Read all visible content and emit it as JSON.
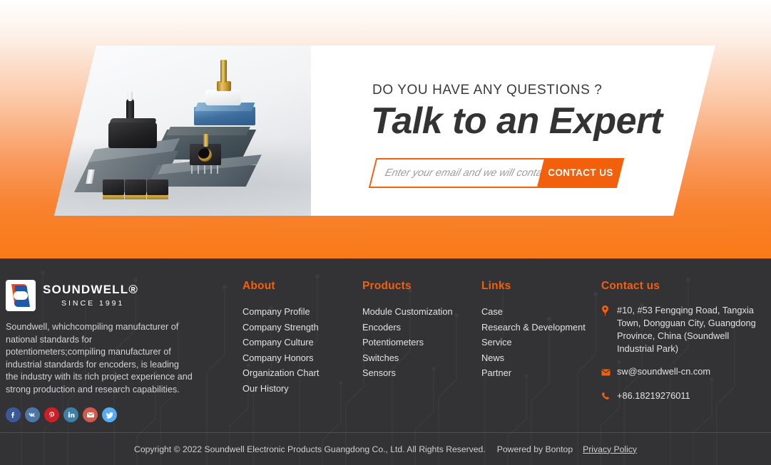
{
  "hero": {
    "eyebrow": "DO YOU HAVE ANY QUESTIONS ?",
    "headline": "Talk to an Expert",
    "email_placeholder": "Enter your email and we will contact you",
    "email_value": "",
    "cta_label": "CONTACT US",
    "accent_color": "#f2600c",
    "background_gradient_from": "#ffffff",
    "background_gradient_to": "#f97a16",
    "photo_alt": "rotary switches, potentiometers and encoders on grey display platforms"
  },
  "footer": {
    "brand": {
      "logo_icon": "soundwell-s-logo-icon",
      "name": "SOUNDWELL®",
      "since": "SINCE 1991",
      "description": "Soundwell, whichcompiling manufacturer of national standards for potentiometers;compiling manufacturer of industrial standards for encoders, is leading the industry with its rich project experience and strong production and research capabilities.",
      "socials": [
        {
          "name": "facebook",
          "icon": "facebook-icon",
          "color": "#3b5998"
        },
        {
          "name": "vk",
          "icon": "vk-icon",
          "color": "#4a76a8"
        },
        {
          "name": "pinterest",
          "icon": "pinterest-icon",
          "color": "#cb2027"
        },
        {
          "name": "linkedin",
          "icon": "linkedin-icon",
          "color": "#3f7fa6"
        },
        {
          "name": "email",
          "icon": "envelope-icon",
          "color": "#cd5c4e"
        },
        {
          "name": "twitter",
          "icon": "twitter-icon",
          "color": "#55acee"
        }
      ]
    },
    "columns": [
      {
        "heading": "About",
        "links": [
          "Company Profile",
          "Company Strength",
          "Company Culture",
          "Company Honors",
          "Organization Chart",
          "Our History"
        ]
      },
      {
        "heading": "Products",
        "links": [
          "Module Customization",
          "Encoders",
          "Potentiometers",
          "Switches",
          "Sensors"
        ]
      },
      {
        "heading": "Links",
        "links": [
          "Case",
          "Research & Development",
          "Service",
          "News",
          "Partner"
        ]
      }
    ],
    "contact": {
      "heading": "Contact us",
      "address_icon": "location-pin-icon",
      "address": "#10, #53 Fengqing Road, Tangxia Town, Dongguan City, Guangdong Province, China (Soundwell Industrial Park)",
      "email_icon": "envelope-icon",
      "email": "sw@soundwell-cn.com",
      "phone_icon": "phone-icon",
      "phone": "+86.18219276011"
    },
    "bottom": {
      "copyright": "Copyright © 2022 Soundwell Electronic Products Guangdong Co., Ltd. All Rights Reserved.",
      "powered": "Powered by Bontop",
      "privacy": "Privacy Policy"
    },
    "background_color": "#333335",
    "heading_color": "#f2600c"
  }
}
